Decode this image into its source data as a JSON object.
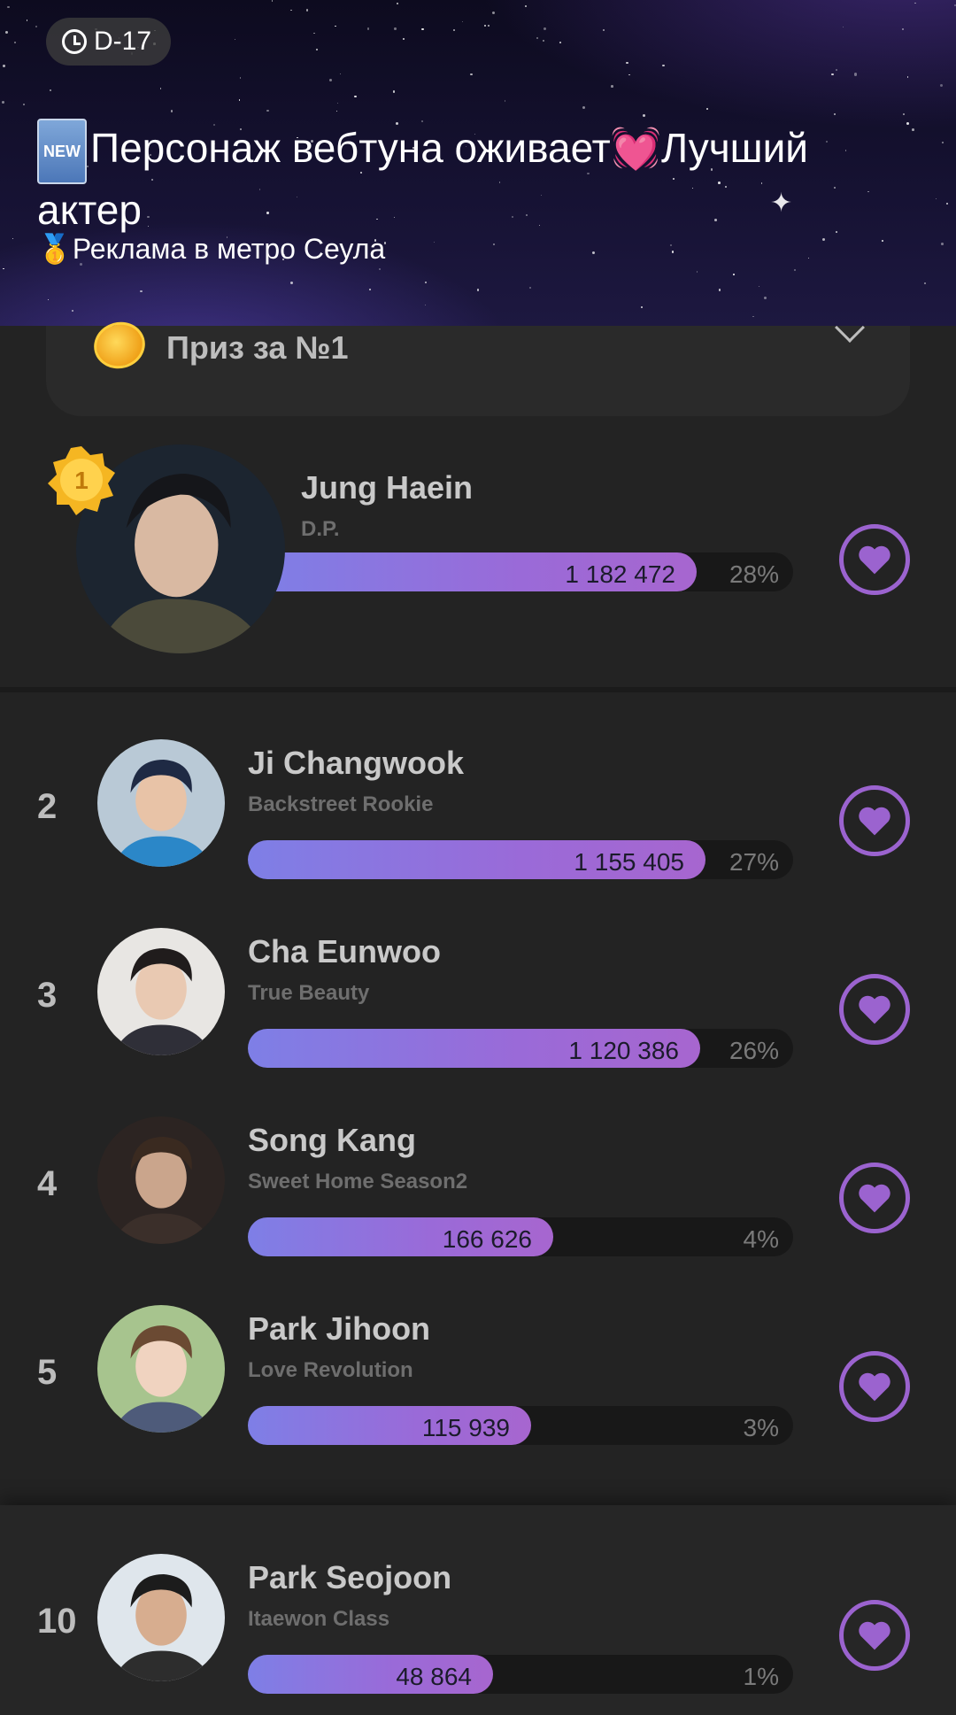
{
  "header": {
    "dday": "D-17",
    "new_badge": "NEW",
    "title_part1": "Персонаж вебтуна оживает",
    "title_heart": "💓",
    "title_part2": "Лучший актер",
    "subtitle_medal": "🥇",
    "subtitle": "Реклама в метро Сеула"
  },
  "prize": {
    "label": "Приз за №1"
  },
  "colors": {
    "accent": "#9b63cf",
    "bar_start": "#7e7fe6",
    "bar_end": "#a766cf",
    "gold": "#f2b520"
  },
  "entries": [
    {
      "rank": "1",
      "name": "Jung Haein",
      "work": "D.P.",
      "votes": "1 182 472",
      "percent": "28%",
      "share": 0.82
    },
    {
      "rank": "2",
      "name": "Ji Changwook",
      "work": "Backstreet Rookie",
      "votes": "1 155 405",
      "percent": "27%",
      "share": 0.84
    },
    {
      "rank": "3",
      "name": "Cha Eunwoo",
      "work": "True Beauty",
      "votes": "1 120 386",
      "percent": "26%",
      "share": 0.83
    },
    {
      "rank": "4",
      "name": "Song Kang",
      "work": "Sweet Home Season2",
      "votes": "166 626",
      "percent": "4%",
      "share": 0.56
    },
    {
      "rank": "5",
      "name": "Park Jihoon",
      "work": "Love Revolution",
      "votes": "115 939",
      "percent": "3%",
      "share": 0.52
    },
    {
      "rank": "10",
      "name": "Park Seojoon",
      "work": "Itaewon Class",
      "votes": "48 864",
      "percent": "1%",
      "share": 0.45
    }
  ]
}
